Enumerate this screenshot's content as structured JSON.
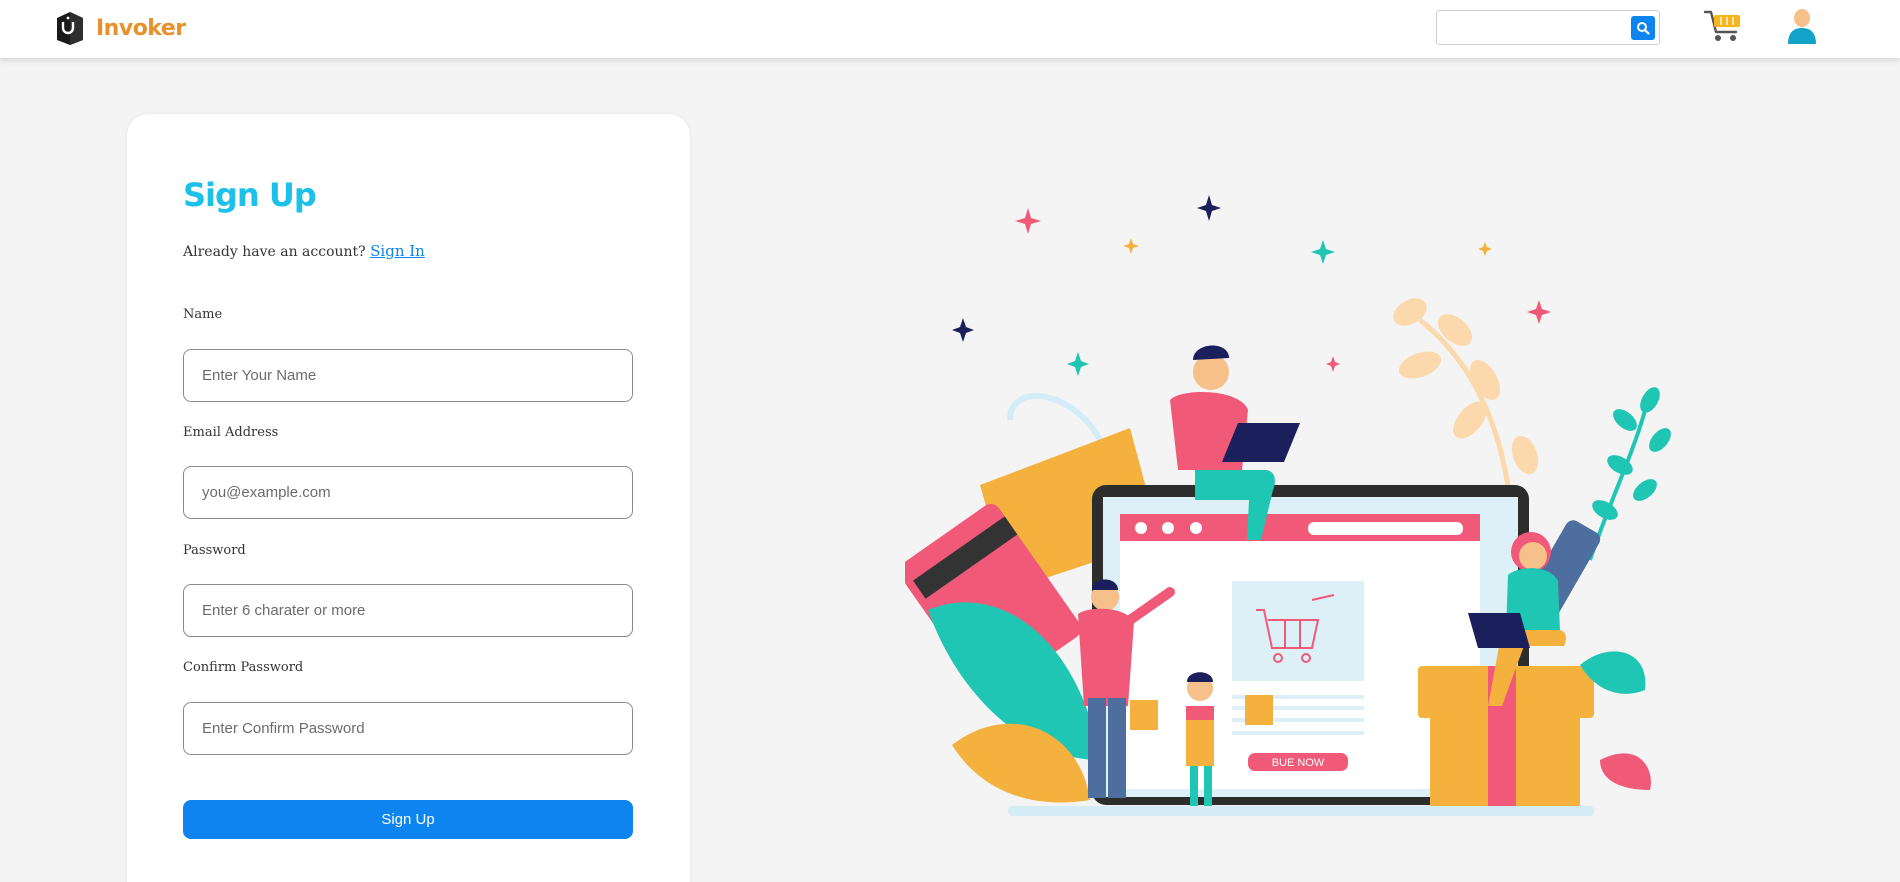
{
  "header": {
    "brand": "Invoker",
    "search": {
      "placeholder": "",
      "value": ""
    },
    "icons": {
      "search": "search-icon",
      "cart": "shopping-cart-icon",
      "user": "user-avatar-icon"
    }
  },
  "signup": {
    "title": "Sign Up",
    "have_account_text": "Already have an account?",
    "signin_link": "Sign In",
    "fields": [
      {
        "label": "Name",
        "placeholder": "Enter Your Name",
        "value": ""
      },
      {
        "label": "Email Address",
        "placeholder": "you@example.com",
        "value": ""
      },
      {
        "label": "Password",
        "placeholder": "Enter 6 charater or more",
        "value": ""
      },
      {
        "label": "Confirm Password",
        "placeholder": "Enter Confirm Password",
        "value": ""
      }
    ],
    "submit_label": "Sign Up"
  },
  "illustration": {
    "button_text": "BUE NOW"
  },
  "colors": {
    "brand": "#e8912c",
    "title": "#1cc0e8",
    "primary": "#0d84f0",
    "background": "#f4f4f4"
  }
}
